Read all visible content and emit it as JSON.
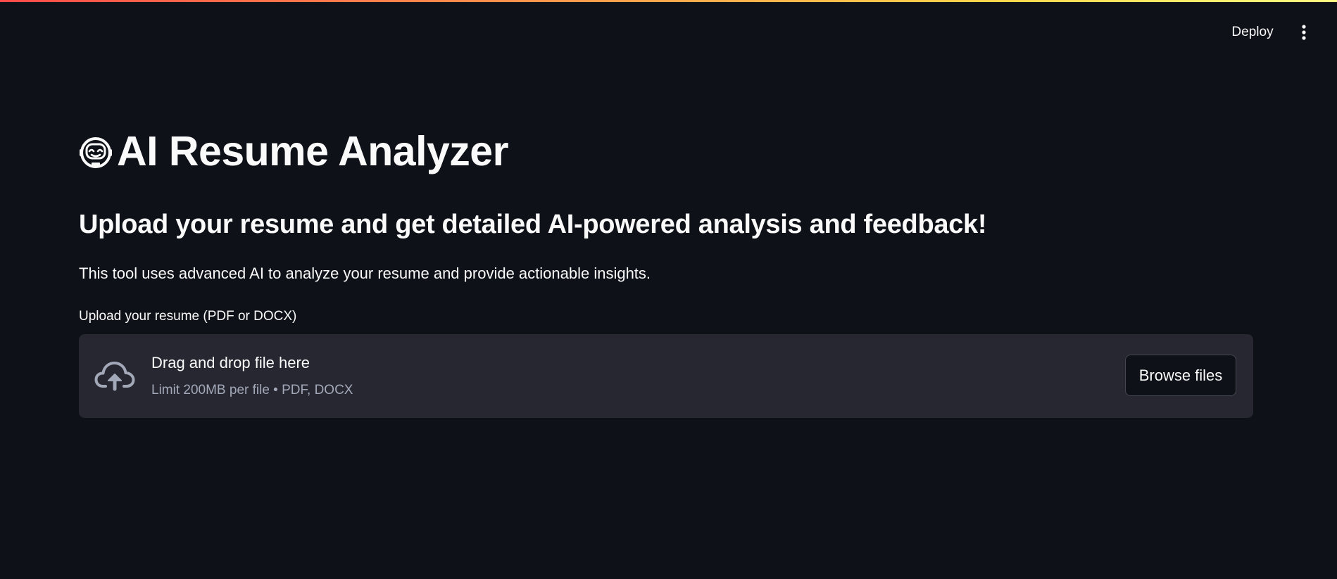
{
  "header": {
    "deploy_label": "Deploy",
    "menu_icon": "vertical-ellipsis-icon"
  },
  "main": {
    "title_icon": "robot-face-icon",
    "title": "AI Resume Analyzer",
    "subtitle": "Upload your resume and get detailed AI-powered analysis and feedback!",
    "description": "This tool uses advanced AI to analyze your resume and provide actionable insights."
  },
  "uploader": {
    "label": "Upload your resume (PDF or DOCX)",
    "icon": "cloud-upload-icon",
    "drop_title": "Drag and drop file here",
    "drop_limit": "Limit 200MB per file • PDF, DOCX",
    "browse_label": "Browse files"
  },
  "colors": {
    "background": "#0e1117",
    "surface": "#262730",
    "text": "#fafafa",
    "muted_text": "#a3a8b8",
    "accent_gradient_start": "#ff4b4b",
    "accent_gradient_end": "#fffd80"
  }
}
